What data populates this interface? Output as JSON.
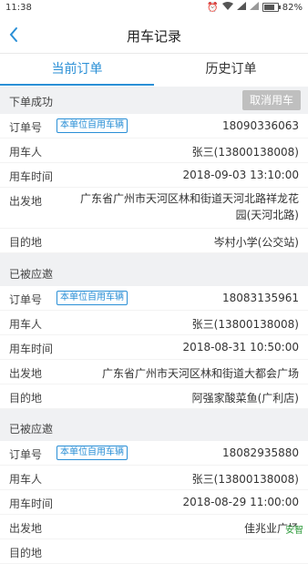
{
  "statusbar": {
    "time": "11:38",
    "battery": "82%"
  },
  "navbar": {
    "title": "用车记录"
  },
  "tabs": [
    {
      "label": "当前订单",
      "active": true
    },
    {
      "label": "历史订单",
      "active": false
    }
  ],
  "orders": [
    {
      "status": "下单成功",
      "cancel_label": "取消用车",
      "order_no_label": "订单号",
      "badge": "本单位自用车辆",
      "order_no": "18090336063",
      "user_label": "用车人",
      "user": "张三(13800138008)",
      "time_label": "用车时间",
      "time": "2018-09-03 13:10:00",
      "from_label": "出发地",
      "from": "广东省广州市天河区林和街道天河北路祥龙花园(天河北路)",
      "to_label": "目的地",
      "to": "岑村小学(公交站)"
    },
    {
      "status": "已被应邀",
      "order_no_label": "订单号",
      "badge": "本单位自用车辆",
      "order_no": "18083135961",
      "user_label": "用车人",
      "user": "张三(13800138008)",
      "time_label": "用车时间",
      "time": "2018-08-31 10:50:00",
      "from_label": "出发地",
      "from": "广东省广州市天河区林和街道大都会广场",
      "to_label": "目的地",
      "to": "阿强家酸菜鱼(广利店)"
    },
    {
      "status": "已被应邀",
      "order_no_label": "订单号",
      "badge": "本单位自用车辆",
      "order_no": "18082935880",
      "user_label": "用车人",
      "user": "张三(13800138008)",
      "time_label": "用车时间",
      "time": "2018-08-29 11:00:00",
      "from_label": "出发地",
      "from": "佳兆业广场",
      "to_label": "目的地",
      "to": ""
    }
  ],
  "watermark": "安智"
}
